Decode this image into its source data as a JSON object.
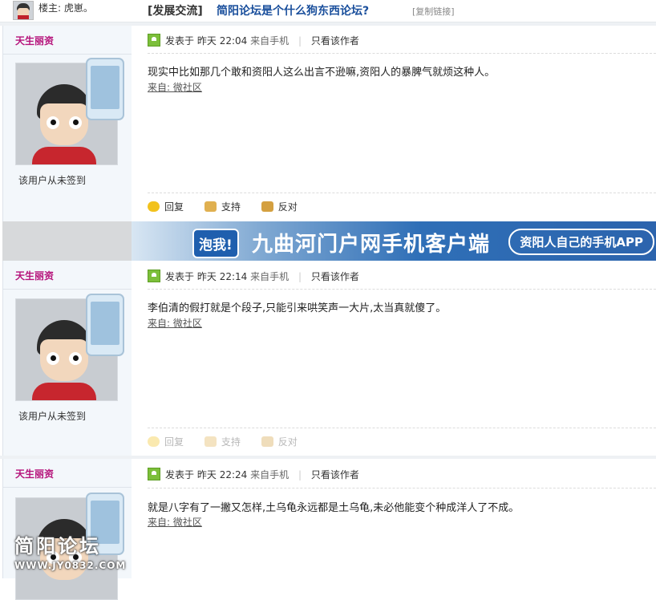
{
  "header": {
    "owner_label": "楼主: 虎崽。",
    "category": "[发展交流]",
    "thread_title": "简阳论坛是个什么狗东西论坛?",
    "copy_link": "[复制链接]"
  },
  "posts": [
    {
      "author": "天生丽资",
      "posted_prefix": "发表于",
      "posted_day": "昨天",
      "posted_time": "22:04",
      "source": "来自手机",
      "only_author": "只看该作者",
      "signin": "该用户从未签到",
      "content": "现实中比如那几个敢和资阳人这么出言不逊嘛,资阳人的暴脾气就烦这种人。",
      "from_link": "来自: 微社区",
      "reply": "回复",
      "support": "支持",
      "oppose": "反对"
    },
    {
      "author": "天生丽资",
      "posted_prefix": "发表于",
      "posted_day": "昨天",
      "posted_time": "22:14",
      "source": "来自手机",
      "only_author": "只看该作者",
      "signin": "该用户从未签到",
      "content": "李伯清的假打就是个段子,只能引来哄笑声一大片,太当真就傻了。",
      "from_link": "来自: 微社区",
      "reply": "回复",
      "support": "支持",
      "oppose": "反对"
    },
    {
      "author": "天生丽资",
      "posted_prefix": "发表于",
      "posted_day": "昨天",
      "posted_time": "22:24",
      "source": "来自手机",
      "only_author": "只看该作者",
      "content": "就是八字有了一撇又怎样,土乌龟永远都是土乌龟,未必他能变个种成洋人了不成。",
      "from_link": "来自: 微社区"
    }
  ],
  "banner": {
    "logo": "泡我!",
    "title": "九曲河门户网手机客户端",
    "tagline": "资阳人自己的手机APP"
  },
  "watermark": {
    "line1": "简阳论坛",
    "line2": "WWW.JY0832.COM"
  },
  "colors": {
    "author": "#b5127a",
    "title_link": "#1a4f9c",
    "banner_blue": "#2c64ad"
  },
  "icons": [
    "post-time-icon",
    "reply-icon",
    "support-icon",
    "oppose-icon",
    "mobile-phone-icon"
  ]
}
